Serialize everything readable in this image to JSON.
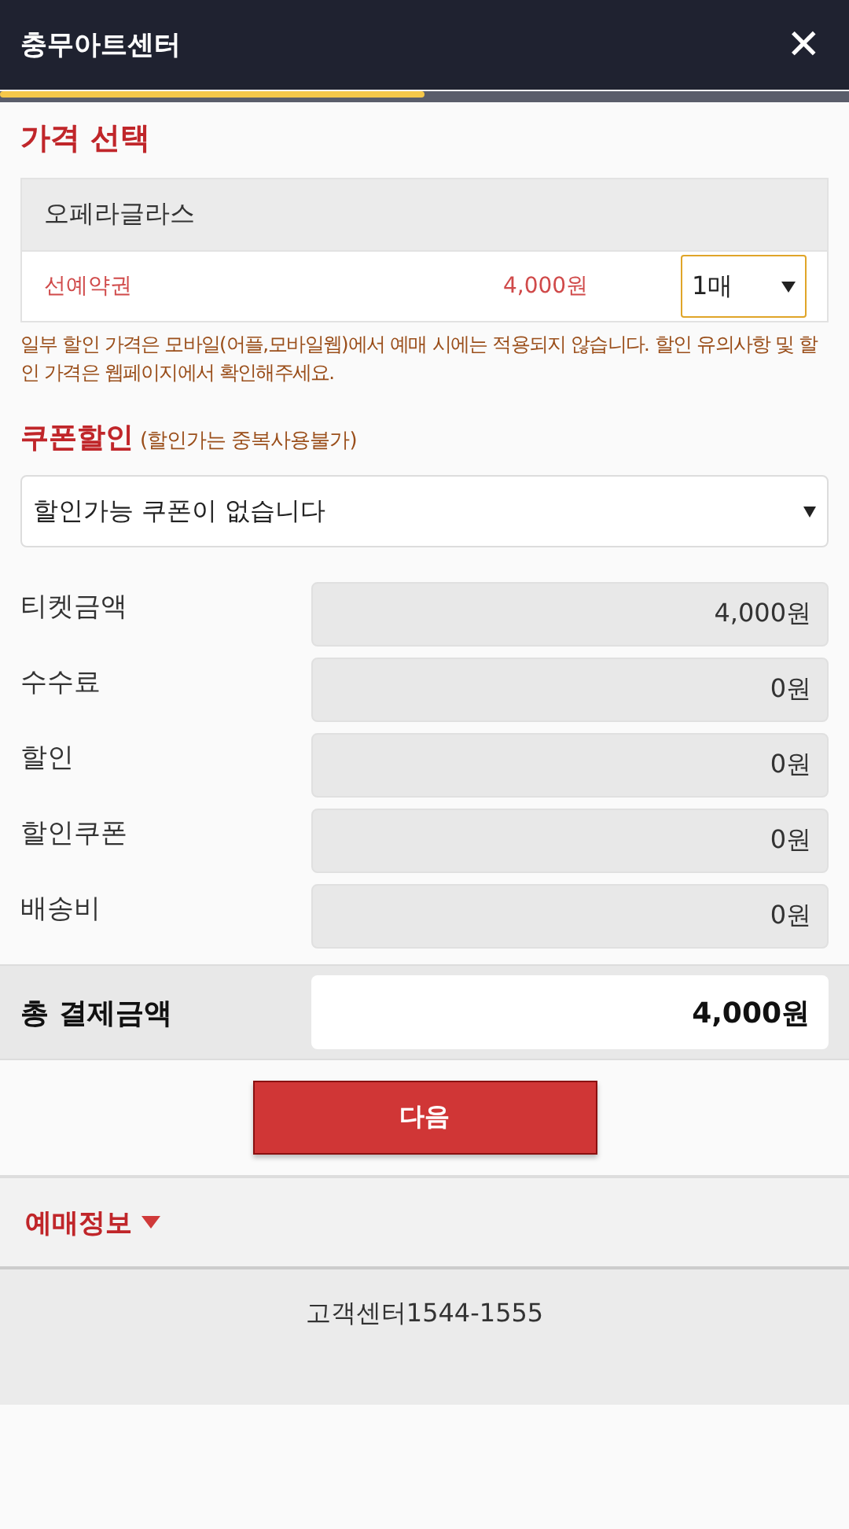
{
  "header": {
    "title": "충무아트센터",
    "close": "✕"
  },
  "progress": {
    "level": 0.5
  },
  "price_section": {
    "title": "가격 선택",
    "seat_grade": "오페라글라스",
    "tickets": [
      {
        "name": "선예약권",
        "price": "4,000원",
        "quantity": "1매"
      }
    ],
    "notice": "일부 할인 가격은 모바일(어플,모바일웹)에서 예매 시에는 적용되지 않습니다. 할인 유의사항 및 할인 가격은 웹페이지에서 확인해주세요."
  },
  "coupon_section": {
    "title": "쿠폰할인",
    "note": "(할인가는 중복사용불가)",
    "select_value": "할인가능 쿠폰이 없습니다"
  },
  "amounts": [
    {
      "label": "티켓금액",
      "value": "4,000원"
    },
    {
      "label": "수수료",
      "value": "0원"
    },
    {
      "label": "할인",
      "value": "0원"
    },
    {
      "label": "할인쿠폰",
      "value": "0원"
    },
    {
      "label": "배송비",
      "value": "0원"
    }
  ],
  "total": {
    "label": "총 결제금액",
    "value": "4,000원"
  },
  "next_button": "다음",
  "booking_info": {
    "label": "예매정보",
    "expanded": false
  },
  "footer": {
    "text": "고객센터1544-1555"
  }
}
